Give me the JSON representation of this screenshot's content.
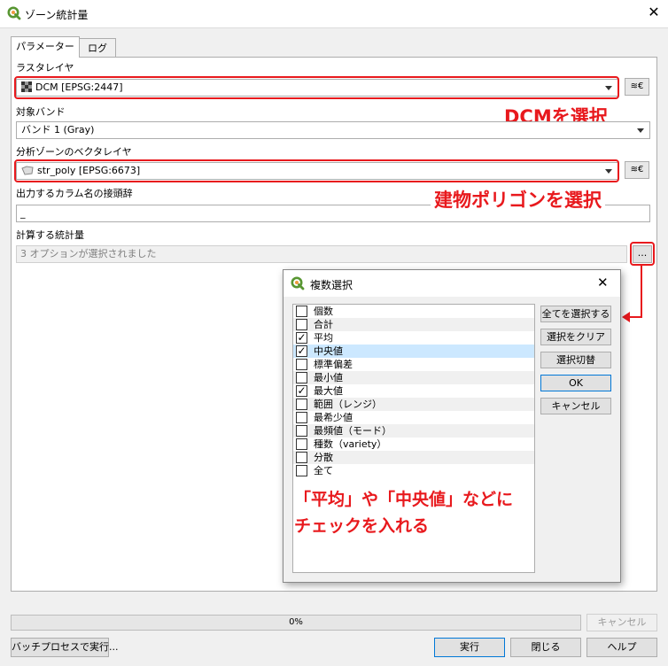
{
  "window": {
    "title": "ゾーン統計量",
    "close_glyph": "✕"
  },
  "tabs": [
    {
      "label": "パラメーター"
    },
    {
      "label": "ログ"
    }
  ],
  "params": {
    "raster_layer_label": "ラスタレイヤ",
    "raster_layer_value": "DCM [EPSG:2447]",
    "band_label": "対象バンド",
    "band_value": "バンド 1 (Gray)",
    "vector_layer_label": "分析ゾーンのベクタレイヤ",
    "vector_layer_value": "str_poly [EPSG:6673]",
    "prefix_label": "出力するカラム名の接頭辞",
    "prefix_value": "_",
    "stats_label": "計算する統計量",
    "stats_value": "3 オプションが選択されました",
    "browse_label": "...",
    "iterate_label": "≋€"
  },
  "annotations": {
    "dcm": "DCMを選択",
    "building": "建物ポリゴンを選択",
    "check_line1": "「平均」や「中央値」などに",
    "check_line2": "チェックを入れる"
  },
  "dialog": {
    "title": "複数選択",
    "close_glyph": "✕",
    "items": [
      {
        "label": "個数",
        "checked": false
      },
      {
        "label": "合計",
        "checked": false
      },
      {
        "label": "平均",
        "checked": true
      },
      {
        "label": "中央値",
        "checked": true
      },
      {
        "label": "標準偏差",
        "checked": false
      },
      {
        "label": "最小値",
        "checked": false
      },
      {
        "label": "最大値",
        "checked": true
      },
      {
        "label": "範囲（レンジ）",
        "checked": false
      },
      {
        "label": "最希少値",
        "checked": false
      },
      {
        "label": "最頻値（モード）",
        "checked": false
      },
      {
        "label": "種数（variety）",
        "checked": false
      },
      {
        "label": "分散",
        "checked": false
      },
      {
        "label": "全て",
        "checked": false
      }
    ],
    "buttons": {
      "select_all": "全てを選択する",
      "clear": "選択をクリア",
      "toggle": "選択切替",
      "ok": "OK",
      "cancel": "キャンセル"
    }
  },
  "footer": {
    "progress_text": "0%",
    "progress_value": 0,
    "cancel": "キャンセル",
    "batch": "バッチプロセスで実行...",
    "run": "実行",
    "close": "閉じる",
    "help": "ヘルプ"
  },
  "colors": {
    "accent_red": "#e8191d",
    "qgis_green": "#589632",
    "selection": "#cce8ff"
  }
}
